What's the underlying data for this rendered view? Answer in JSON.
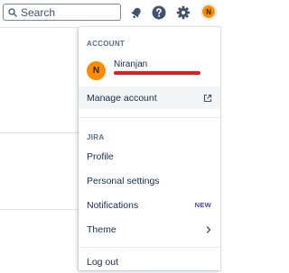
{
  "search": {
    "placeholder": "Search"
  },
  "topbar": {
    "notifications_icon": "bell-icon",
    "help_icon": "help-icon",
    "settings_icon": "gear-icon",
    "avatar_initial": "N"
  },
  "menu": {
    "account_section": {
      "label": "ACCOUNT",
      "user": {
        "initial": "N",
        "name": "Niranjan"
      },
      "manage_account": {
        "label": "Manage account",
        "icon": "external-link-icon"
      }
    },
    "jira_section": {
      "label": "JIRA",
      "items": [
        {
          "label": "Profile"
        },
        {
          "label": "Personal settings"
        },
        {
          "label": "Notifications",
          "badge": "NEW"
        },
        {
          "label": "Theme",
          "icon": "chevron-right-icon"
        }
      ]
    },
    "logout": {
      "label": "Log out"
    }
  },
  "colors": {
    "avatar": "#ff8b00",
    "new_badge": "#5243aa",
    "text": "#172b4d",
    "hover": "#f4f5f7"
  }
}
